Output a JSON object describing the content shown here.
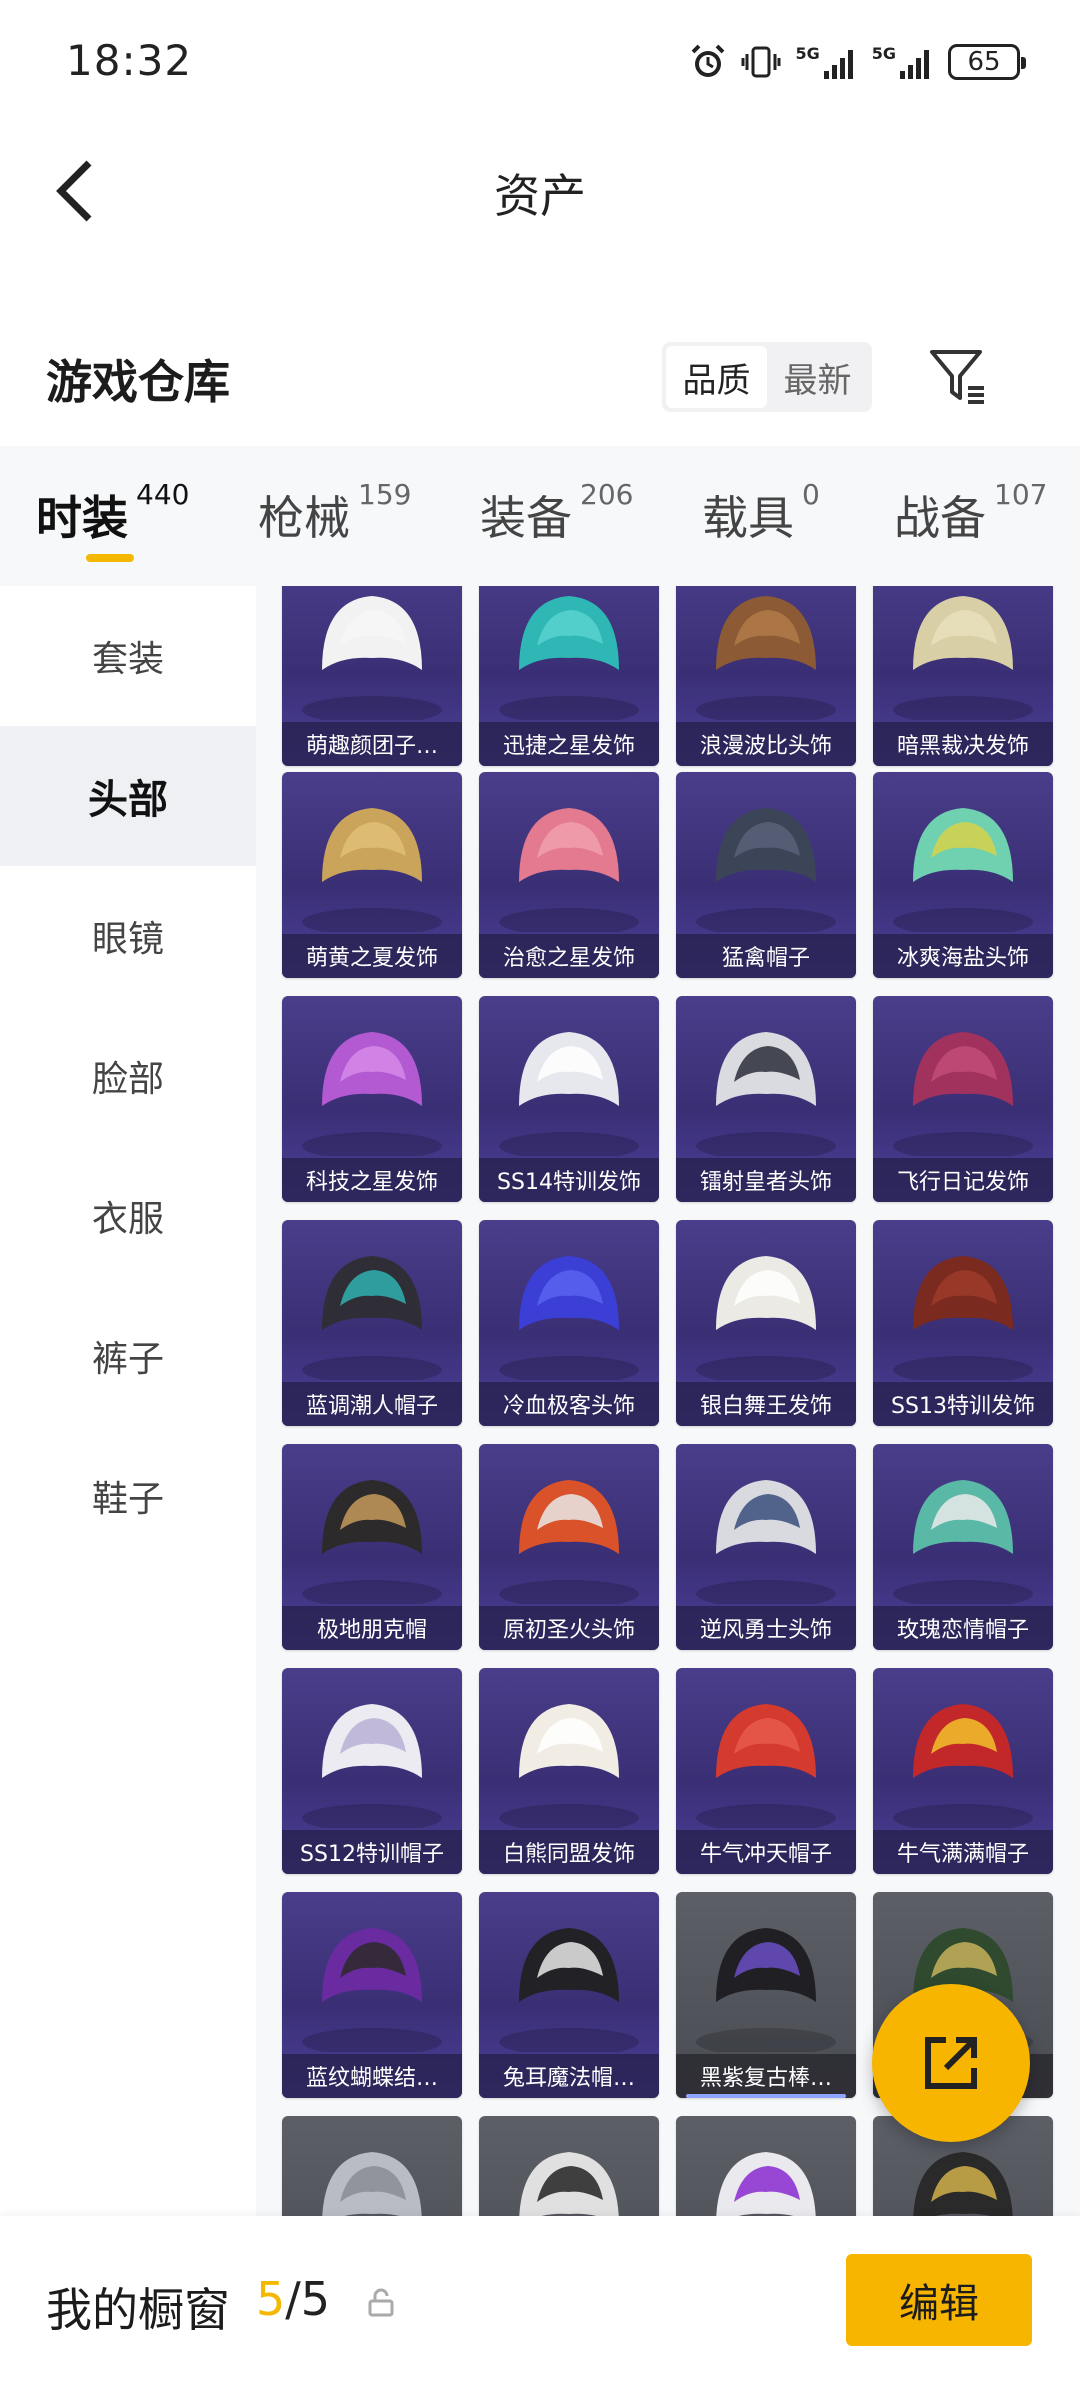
{
  "status_bar": {
    "time": "18:32",
    "network_1": "5G",
    "network_2": "5G",
    "battery": "65"
  },
  "nav": {
    "title": "资产"
  },
  "warehouse": {
    "title": "游戏仓库",
    "sort_options": [
      "品质",
      "最新"
    ],
    "active_sort": "品质"
  },
  "tabs": [
    {
      "label": "时装",
      "count": "440",
      "active": true
    },
    {
      "label": "枪械",
      "count": "159"
    },
    {
      "label": "装备",
      "count": "206"
    },
    {
      "label": "载具",
      "count": "0"
    },
    {
      "label": "战备",
      "count": "107"
    }
  ],
  "sidebar": {
    "items": [
      {
        "label": "套装"
      },
      {
        "label": "头部",
        "active": true
      },
      {
        "label": "眼镜"
      },
      {
        "label": "脸部"
      },
      {
        "label": "衣服"
      },
      {
        "label": "裤子"
      },
      {
        "label": "鞋子"
      }
    ]
  },
  "items": [
    {
      "name": "萌趣颜团子…",
      "icon": "white-dumpling-hat"
    },
    {
      "name": "迅捷之星发饰",
      "icon": "teal-hair"
    },
    {
      "name": "浪漫波比头饰",
      "icon": "bear-head"
    },
    {
      "name": "暗黑裁决发饰",
      "icon": "beige-long-hair"
    },
    {
      "name": "萌黄之夏发饰",
      "icon": "blonde-hair"
    },
    {
      "name": "治愈之星发饰",
      "icon": "pink-hair"
    },
    {
      "name": "猛禽帽子",
      "icon": "aviator-cap"
    },
    {
      "name": "冰爽海盐头饰",
      "icon": "mint-hair-with-hat"
    },
    {
      "name": "科技之星发饰",
      "icon": "purple-hair"
    },
    {
      "name": "SS14特训发饰",
      "icon": "silver-hair"
    },
    {
      "name": "镭射皇者头饰",
      "icon": "white-cap-hair"
    },
    {
      "name": "飞行日记发饰",
      "icon": "magenta-hair"
    },
    {
      "name": "蓝调潮人帽子",
      "icon": "fedora-hat"
    },
    {
      "name": "冷血极客头饰",
      "icon": "blue-hair"
    },
    {
      "name": "银白舞王发饰",
      "icon": "white-braid-hair"
    },
    {
      "name": "SS13特训发饰",
      "icon": "red-brown-hair"
    },
    {
      "name": "极地朋克帽",
      "icon": "officer-cap"
    },
    {
      "name": "原初圣火头饰",
      "icon": "armored-helmet"
    },
    {
      "name": "逆风勇士头饰",
      "icon": "ski-helmet"
    },
    {
      "name": "玫瑰恋情帽子",
      "icon": "rose-hat"
    },
    {
      "name": "SS12特训帽子",
      "icon": "beret-hair"
    },
    {
      "name": "白熊同盟发饰",
      "icon": "white-curly-hair"
    },
    {
      "name": "牛气冲天帽子",
      "icon": "red-baseball-cap"
    },
    {
      "name": "牛气满满帽子",
      "icon": "bull-hat"
    },
    {
      "name": "蓝纹蝴蝶结…",
      "icon": "purple-bow-hair"
    },
    {
      "name": "兔耳魔法帽…",
      "icon": "bunny-top-hat"
    },
    {
      "name": "黑紫复古棒…",
      "icon": "black-baseball-cap"
    },
    {
      "name": "…",
      "icon": "green-beanie"
    },
    {
      "name": "",
      "icon": "gray-helmet"
    },
    {
      "name": "",
      "icon": "zebra-hat"
    },
    {
      "name": "",
      "icon": "white-helmet"
    },
    {
      "name": "",
      "icon": "dark-helmet"
    }
  ],
  "showcase": {
    "title": "我的橱窗",
    "current": "5",
    "separator": "/",
    "total": "5",
    "edit_label": "编辑"
  }
}
